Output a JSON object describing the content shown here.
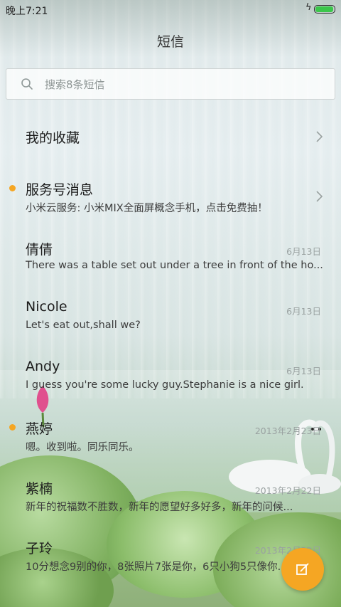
{
  "status_bar": {
    "time": "晚上7:21",
    "flash_icon": "flash-icon",
    "battery_icon": "battery-icon",
    "battery_level": 0.95,
    "battery_color": "#3bc64b"
  },
  "header": {
    "title": "短信"
  },
  "search": {
    "placeholder": "搜索8条短信",
    "icon": "search-icon"
  },
  "list": {
    "items": [
      {
        "name": "我的收藏",
        "preview": "",
        "date": "",
        "unread": false,
        "chevron": true
      },
      {
        "name": "服务号消息",
        "preview": "小米云服务: 小米MIX全面屏概念手机，点击免费抽！",
        "date": "",
        "unread": true,
        "chevron": true
      },
      {
        "name": "倩倩",
        "preview": "There was a table set out under a tree in front of the ho...",
        "date": "6月13日",
        "unread": false,
        "chevron": false
      },
      {
        "name": "Nicole",
        "preview": "Let's eat out,shall we?",
        "date": "6月13日",
        "unread": false,
        "chevron": false
      },
      {
        "name": "Andy",
        "preview": "I guess you're some lucky guy.Stephanie is a nice girl.",
        "date": "6月13日",
        "unread": false,
        "chevron": false
      },
      {
        "name": "燕婷",
        "preview": "嗯。收到啦。同乐同乐。",
        "date": "2013年2月23日",
        "unread": true,
        "chevron": false
      },
      {
        "name": "紫楠",
        "preview": "新年的祝福数不胜数，新年的愿望好多好多，新年的问候...",
        "date": "2013年2月22日",
        "unread": false,
        "chevron": false
      },
      {
        "name": "子玲",
        "preview": "10分想念9别的你，8张照片7张是你，6只小狗5只像你...",
        "date": "2013年2月22日",
        "unread": false,
        "chevron": false
      }
    ]
  },
  "fab": {
    "icon": "compose-icon",
    "color": "#f5a623"
  },
  "colors": {
    "unread_dot": "#f5a623",
    "accent": "#f5a623"
  }
}
